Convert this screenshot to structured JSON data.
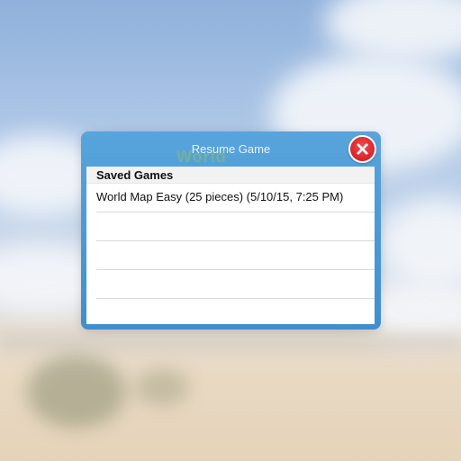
{
  "dialog": {
    "title": "Resume Game",
    "watermark": "World",
    "close_icon": "close-icon",
    "list": {
      "header": "Saved Games",
      "rows": [
        "World Map Easy (25 pieces) (5/10/15, 7:25 PM)",
        "",
        "",
        "",
        ""
      ]
    }
  },
  "colors": {
    "dialog_blue": "#4a9bd6",
    "close_red": "#d8232a"
  }
}
